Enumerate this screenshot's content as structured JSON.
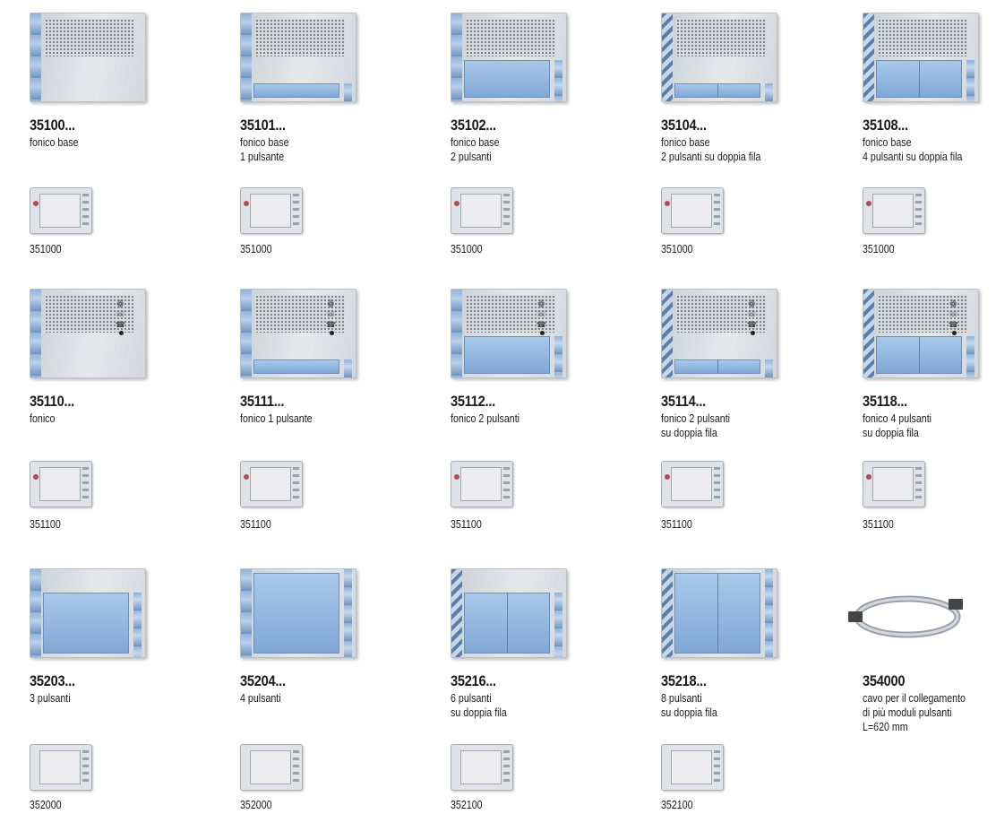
{
  "rows": [
    {
      "items": [
        {
          "code": "35100...",
          "desc": [
            "fonico base"
          ],
          "subcode": "351000"
        },
        {
          "code": "35101...",
          "desc": [
            "fonico base",
            "1 pulsante"
          ],
          "subcode": "351000"
        },
        {
          "code": "35102...",
          "desc": [
            "fonico base",
            "2 pulsanti"
          ],
          "subcode": "351000"
        },
        {
          "code": "35104...",
          "desc": [
            "fonico base",
            "2 pulsanti su doppia fila"
          ],
          "subcode": "351000"
        },
        {
          "code": "35108...",
          "desc": [
            "fonico base",
            "4 pulsanti su doppia fila"
          ],
          "subcode": "351000"
        }
      ]
    },
    {
      "items": [
        {
          "code": "35110...",
          "desc": [
            "fonico"
          ],
          "subcode": "351100"
        },
        {
          "code": "35111...",
          "desc": [
            "fonico 1 pulsante"
          ],
          "subcode": "351100"
        },
        {
          "code": "35112...",
          "desc": [
            "fonico 2 pulsanti"
          ],
          "subcode": "351100"
        },
        {
          "code": "35114...",
          "desc": [
            "fonico 2 pulsanti",
            "su doppia fila"
          ],
          "subcode": "351100"
        },
        {
          "code": "35118...",
          "desc": [
            "fonico 4 pulsanti",
            "su doppia fila"
          ],
          "subcode": "351100"
        }
      ]
    },
    {
      "items": [
        {
          "code": "35203...",
          "desc": [
            "3 pulsanti"
          ],
          "subcode": "352000"
        },
        {
          "code": "35204...",
          "desc": [
            "4 pulsanti"
          ],
          "subcode": "352000"
        },
        {
          "code": "35216...",
          "desc": [
            "6 pulsanti",
            "su doppia fila"
          ],
          "subcode": "352100"
        },
        {
          "code": "35218...",
          "desc": [
            "8 pulsanti",
            "su doppia fila"
          ],
          "subcode": "352100"
        },
        {
          "code": "354000",
          "desc": [
            "cavo per il collegamento",
            "di più moduli pulsanti",
            "L=620 mm"
          ],
          "subcode": ""
        }
      ]
    }
  ],
  "icons": {
    "speaker_symbols": "☏ ⌂ ⚿"
  }
}
